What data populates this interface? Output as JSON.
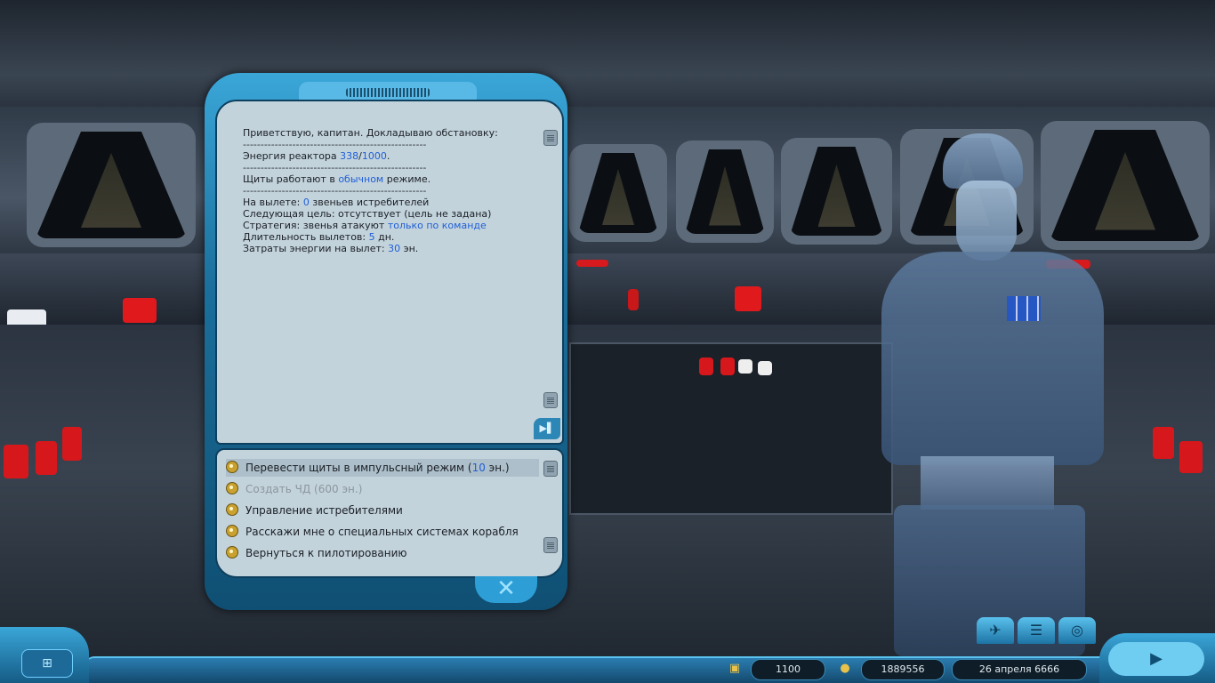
{
  "report": {
    "greeting": "Приветствую, капитан. Докладываю обстановку:",
    "separator": "----------------------------------------------------",
    "reactor_label": "Энергия реактора ",
    "reactor_current": "338",
    "reactor_slash": "/",
    "reactor_max": "1000",
    "reactor_end": ".",
    "shields_prefix": "Щиты работают в ",
    "shields_mode": "обычном",
    "shields_suffix": " режиме.",
    "flight_prefix": "На вылете: ",
    "flight_count": "0",
    "flight_suffix": " звеньев истребителей",
    "next_target": "Следующая цель: отсутствует (цель не задана)",
    "strategy_prefix": "Стратегия: звенья атакуют ",
    "strategy_value": "только по команде",
    "duration_prefix": "Длительность вылетов: ",
    "duration_value": "5",
    "duration_suffix": " дн.",
    "energy_cost_prefix": "Затраты энергии на вылет: ",
    "energy_cost_value": "30",
    "energy_cost_suffix": " эн."
  },
  "answers": {
    "shields_pulse_prefix": "Перевести щиты в импульсный режим (",
    "shields_pulse_cost": "10",
    "shields_pulse_suffix": " эн.)",
    "create_black_hole": "Создать ЧД (600 эн.)",
    "fighter_control": "Управление истребителями",
    "special_systems": "Расскажи мне о специальных системах корабля",
    "back_to_piloting": "Вернуться к пилотированию"
  },
  "hud": {
    "stat1": "1100",
    "money": "1889556",
    "date": "26 апреля 6666"
  },
  "icons": {
    "answer": "magnifier-icon",
    "close": "close-icon",
    "play": "play-icon"
  },
  "colors": {
    "panel": "#c3d3dc",
    "frame": "#1b6f9c",
    "value_text": "#1f5fd6"
  }
}
